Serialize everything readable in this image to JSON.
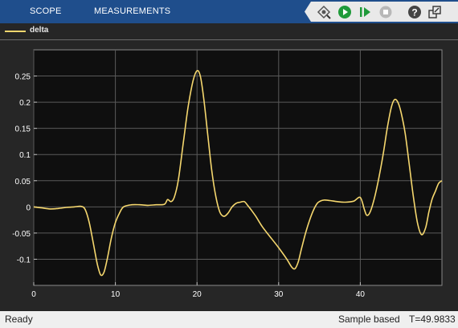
{
  "header": {
    "tabs": [
      {
        "label": "SCOPE"
      },
      {
        "label": "MEASUREMENTS"
      }
    ],
    "toolbar_icons": [
      "signal-select-icon",
      "run-icon",
      "step-forward-icon",
      "stop-icon",
      "help-icon",
      "undock-icon"
    ]
  },
  "legend": {
    "label": "delta",
    "color": "#f5d76e"
  },
  "status": {
    "state": "Ready",
    "mode": "Sample based",
    "time": "T=49.9833"
  },
  "colors": {
    "plot_bg": "#0f0f0f",
    "axes_bg": "#262626",
    "grid": "#5a5a5a",
    "tick_text": "#ffffff",
    "header_bg": "#1f4e8c"
  },
  "chart_data": {
    "type": "line",
    "title": "",
    "xlabel": "",
    "ylabel": "",
    "xlim": [
      0,
      50
    ],
    "ylim": [
      -0.15,
      0.3
    ],
    "xticks": [
      0,
      10,
      20,
      30,
      40
    ],
    "xtick_labels": [
      "0",
      "10",
      "20",
      "30",
      "40"
    ],
    "yticks": [
      -0.1,
      -0.05,
      0,
      0.05,
      0.1,
      0.15,
      0.2,
      0.25
    ],
    "ytick_labels": [
      "-0.1",
      "-0.05",
      "0",
      "0.05",
      "0.1",
      "0.15",
      "0.2",
      "0.25"
    ],
    "grid": true,
    "legend_position": "top-left",
    "series": [
      {
        "name": "delta",
        "color": "#f5d76e",
        "x": [
          0,
          1,
          2,
          3,
          4,
          5,
          5.8,
          6.3,
          6.8,
          7.3,
          7.8,
          8.2,
          8.6,
          9.0,
          9.5,
          10,
          10.5,
          11,
          12,
          13,
          14,
          15,
          16,
          16.4,
          16.8,
          17.2,
          17.7,
          18.3,
          18.9,
          19.5,
          20.0,
          20.4,
          20.8,
          21.3,
          21.8,
          22.3,
          22.8,
          23.3,
          23.8,
          24.3,
          24.8,
          25.3,
          25.8,
          26.2,
          26.6,
          27.2,
          28,
          29,
          30,
          31,
          31.6,
          32.0,
          32.4,
          32.8,
          33.3,
          33.8,
          34.3,
          34.8,
          35.5,
          36.3,
          37.2,
          38.2,
          39.2,
          40.0,
          40.5,
          40.8,
          41.2,
          41.7,
          42.2,
          42.8,
          43.3,
          43.8,
          44.2,
          44.6,
          45.0,
          45.5,
          46.0,
          46.5,
          47.0,
          47.5,
          48.0,
          48.4,
          48.8,
          49.2,
          49.6,
          50.0
        ],
        "values": [
          0,
          -0.002,
          -0.004,
          -0.003,
          -0.001,
          0,
          0.001,
          -0.005,
          -0.03,
          -0.07,
          -0.11,
          -0.13,
          -0.125,
          -0.1,
          -0.06,
          -0.03,
          -0.012,
          0,
          0.004,
          0.004,
          0.003,
          0.004,
          0.005,
          0.014,
          0.01,
          0.018,
          0.05,
          0.12,
          0.19,
          0.24,
          0.26,
          0.25,
          0.21,
          0.14,
          0.07,
          0.02,
          -0.01,
          -0.018,
          -0.012,
          0,
          0.007,
          0.009,
          0.01,
          0.003,
          -0.005,
          -0.018,
          -0.038,
          -0.058,
          -0.078,
          -0.1,
          -0.115,
          -0.118,
          -0.105,
          -0.08,
          -0.05,
          -0.025,
          -0.005,
          0.008,
          0.013,
          0.012,
          0.01,
          0.009,
          0.011,
          0.018,
          -0.005,
          -0.016,
          -0.01,
          0.015,
          0.05,
          0.1,
          0.15,
          0.19,
          0.205,
          0.2,
          0.18,
          0.14,
          0.08,
          0.02,
          -0.03,
          -0.053,
          -0.04,
          -0.01,
          0.015,
          0.03,
          0.045,
          0.05
        ]
      }
    ]
  }
}
